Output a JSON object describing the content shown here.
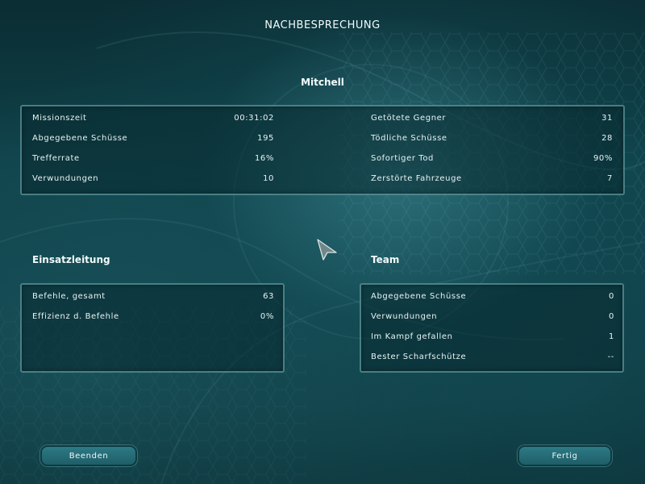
{
  "screen": {
    "title": "NACHBESPRECHUNG",
    "player_name": "Mitchell"
  },
  "stats_left": [
    {
      "label": "Missionszeit",
      "value": "00:31:02"
    },
    {
      "label": "Abgegebene Schüsse",
      "value": "195"
    },
    {
      "label": "Trefferrate",
      "value": "16%"
    },
    {
      "label": "Verwundungen",
      "value": "10"
    }
  ],
  "stats_right": [
    {
      "label": "Getötete Gegner",
      "value": "31"
    },
    {
      "label": "Tödliche Schüsse",
      "value": "28"
    },
    {
      "label": "Sofortiger Tod",
      "value": "90%"
    },
    {
      "label": "Zerstörte Fahrzeuge",
      "value": "7"
    }
  ],
  "command": {
    "heading": "Einsatzleitung",
    "rows": [
      {
        "label": "Befehle, gesamt",
        "value": "63"
      },
      {
        "label": "Effizienz d. Befehle",
        "value": "0%"
      }
    ]
  },
  "team": {
    "heading": "Team",
    "rows": [
      {
        "label": "Abgegebene Schüsse",
        "value": "0"
      },
      {
        "label": "Verwundungen",
        "value": "0"
      },
      {
        "label": "Im Kampf gefallen",
        "value": "1"
      },
      {
        "label": "Bester Scharfschütze",
        "value": "--"
      }
    ]
  },
  "buttons": {
    "quit_label": "Beenden",
    "done_label": "Fertig"
  },
  "icons": {
    "cursor": "arrow-cursor-icon"
  },
  "colors": {
    "background": "#0f4149",
    "panel_border": "#78bec3",
    "button": "#2d7a85"
  }
}
